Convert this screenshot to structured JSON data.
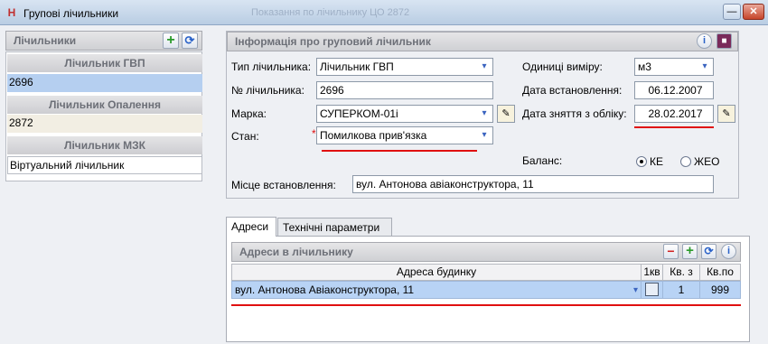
{
  "window": {
    "title": "Групові лічильники",
    "background_caption": "Показання по лічильнику ЦО 2872",
    "minimize_label": "—",
    "close_label": "✕"
  },
  "left": {
    "header": "Лічильники",
    "groups": [
      {
        "title": "Лічильник ГВП",
        "value": "2696"
      },
      {
        "title": "Лічильник Опалення",
        "value": "2872"
      },
      {
        "title": "Лічильник МЗК",
        "value": "Віртуальний лічильник"
      }
    ]
  },
  "info": {
    "header": "Інформація про груповий лічильник",
    "type_label": "Тип лічильника:",
    "type_value": "Лічильник ГВП",
    "number_label": "№ лічильника:",
    "number_value": "2696",
    "brand_label": "Марка:",
    "brand_value": "СУПЕРКОМ-01і",
    "state_label": "Стан:",
    "state_required_mark": "*",
    "state_value": "Помилкова прив'язка",
    "unit_label": "Одиниці виміру:",
    "unit_value": "м3",
    "install_date_label": "Дата встановлення:",
    "install_date_value": "06.12.2007",
    "removal_date_label": "Дата зняття з обліку:",
    "removal_date_value": "28.02.2017",
    "balance_label": "Баланс:",
    "balance_options": [
      "КЕ",
      "ЖЕО"
    ],
    "balance_selected": "КЕ",
    "location_label": "Місце встановлення:",
    "location_value": "вул. Антонова авіаконструктора, 11"
  },
  "tabs": [
    "Адреси",
    "Технічні параметри"
  ],
  "addresses": {
    "header": "Адреси в лічильнику",
    "columns": [
      "Адреса будинку",
      "1кв",
      "Кв. з",
      "Кв.по"
    ],
    "rows": [
      {
        "address": "вул. Антонова Авіаконструктора, 11",
        "first_apt": false,
        "from": "1",
        "to": "999"
      }
    ]
  },
  "colors": {
    "highlight": "#e01010",
    "selection": "#b8d3f5",
    "add": "#2a9a2a",
    "remove": "#d02020",
    "refresh": "#2a62c8"
  }
}
